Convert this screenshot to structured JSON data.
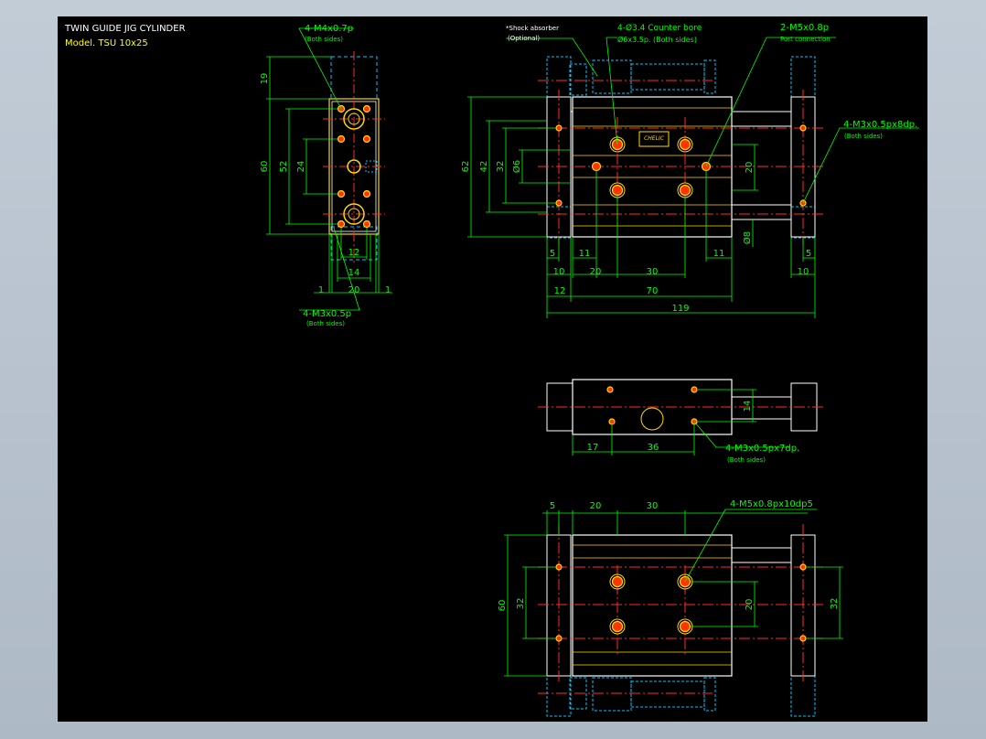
{
  "title_block": {
    "line1": "TWIN GUIDE JIG CYLINDER",
    "line2": "Model. TSU 10x25"
  },
  "colors": {
    "background": "#000000",
    "body_outline": "#ffffff",
    "hidden_lines": "#00c8ff",
    "dimensions": "#00ff00",
    "centerlines": "#ff2a2a",
    "holes": "#ffd700",
    "text": "#ffffff",
    "accent_text": "#ffff00"
  },
  "notes": {
    "left_top_callout": "4-M4x0.7p",
    "left_top_sub": "(Both sides)",
    "left_bottom_callout": "4-M3x0.5p",
    "left_bottom_sub": "(Both sides)",
    "shock": "*Shock absorber",
    "shock_sub": "(Optional)",
    "counterbore": "4-Ø3.4 Counter bore",
    "counterbore_sub": "Ø6x3.5p. (Both sides)",
    "port": "2-M5x0.8p",
    "port_sub": "Port connection",
    "right_callout": "4-M3x0.5px8dp.",
    "right_sub": "(Both sides)",
    "mid_callout": "4-M3x0.5px7dp.",
    "mid_sub": "(Both sides)",
    "bot_callout": "4-M5x0.8px10dp5"
  },
  "dimensions": {
    "left": {
      "d19": "19",
      "d60": "60",
      "d52": "52",
      "d24": "24",
      "d12": "12",
      "d14": "14",
      "d1a": "1",
      "d20": "20",
      "d1b": "1"
    },
    "front": {
      "d62": "62",
      "d42": "42",
      "d32": "32",
      "d6": "Ø6",
      "d20": "20",
      "d8": "Ø8",
      "d5": "5",
      "d11a": "11",
      "d11b": "11",
      "d5r": "5",
      "d10": "10",
      "d20b": "20",
      "d30": "30",
      "d10r": "10",
      "d12": "12",
      "d70": "70",
      "d119": "119"
    },
    "middle": {
      "d14": "14",
      "d17": "17",
      "d36": "36"
    },
    "bottom": {
      "d5": "5",
      "d20": "20",
      "d30": "30",
      "d60": "60",
      "d32": "32",
      "d20v": "20",
      "d32r": "32"
    }
  }
}
